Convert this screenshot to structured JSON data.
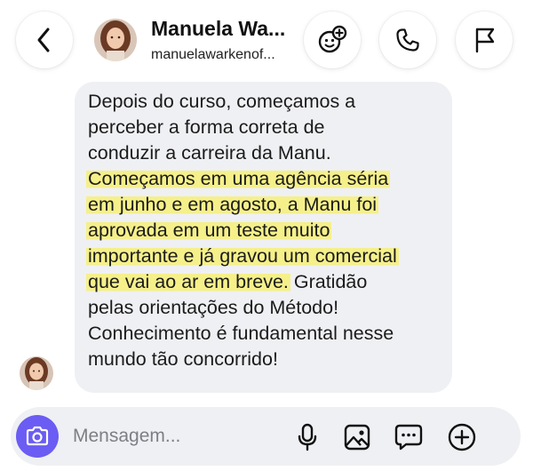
{
  "header": {
    "name": "Manuela Wa...",
    "username": "manuelawarkenof...",
    "buttons": {
      "back_icon": "chevron-left-icon",
      "effects_icon": "face-effects-icon",
      "call_icon": "phone-icon",
      "report_icon": "flag-icon"
    }
  },
  "message": {
    "lines": [
      {
        "text": "Depois do curso, começamos a",
        "highlight": false
      },
      {
        "text": "perceber a forma correta de",
        "highlight": false
      },
      {
        "text": "conduzir a carreira da Manu.",
        "highlight": false
      },
      {
        "text": "Começamos em uma agência séria",
        "highlight": true
      },
      {
        "text": "em junho e em agosto, a Manu foi",
        "highlight": true
      },
      {
        "text": "aprovada em um teste muito",
        "highlight": true
      },
      {
        "text": "importante e já gravou um comercial",
        "highlight": true
      },
      {
        "hl_text": "que vai ao ar em breve.",
        "rest": " Gratidão"
      },
      {
        "text": "pelas orientações do Método!",
        "highlight": false
      },
      {
        "text": "Conhecimento é fundamental nesse",
        "highlight": false
      },
      {
        "text": "mundo tão concorrido!",
        "highlight": false
      }
    ],
    "highlight_color": "#f5f08a",
    "bubble_color": "#eff0f3"
  },
  "composer": {
    "placeholder": "Mensagem...",
    "value": "",
    "camera_color": "#6b5cf3",
    "icons": [
      "camera-icon",
      "microphone-icon",
      "image-icon",
      "sticker-icon",
      "plus-circle-icon"
    ]
  }
}
